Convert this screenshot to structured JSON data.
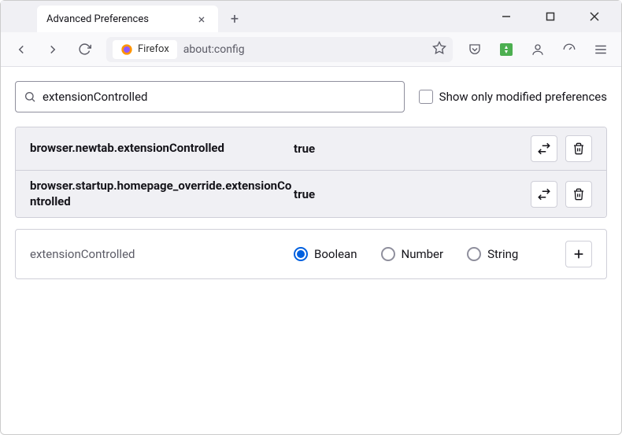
{
  "window": {
    "tab_title": "Advanced Preferences"
  },
  "urlbar": {
    "badge": "Firefox",
    "url": "about:config"
  },
  "search": {
    "value": "extensionControlled",
    "modified_label": "Show only modified preferences"
  },
  "prefs": [
    {
      "name": "browser.newtab.extensionControlled",
      "value": "true"
    },
    {
      "name": "browser.startup.homepage_override.extensionControlled",
      "value": "true"
    }
  ],
  "new_pref": {
    "name": "extensionControlled",
    "types": {
      "boolean": "Boolean",
      "number": "Number",
      "string": "String"
    }
  }
}
